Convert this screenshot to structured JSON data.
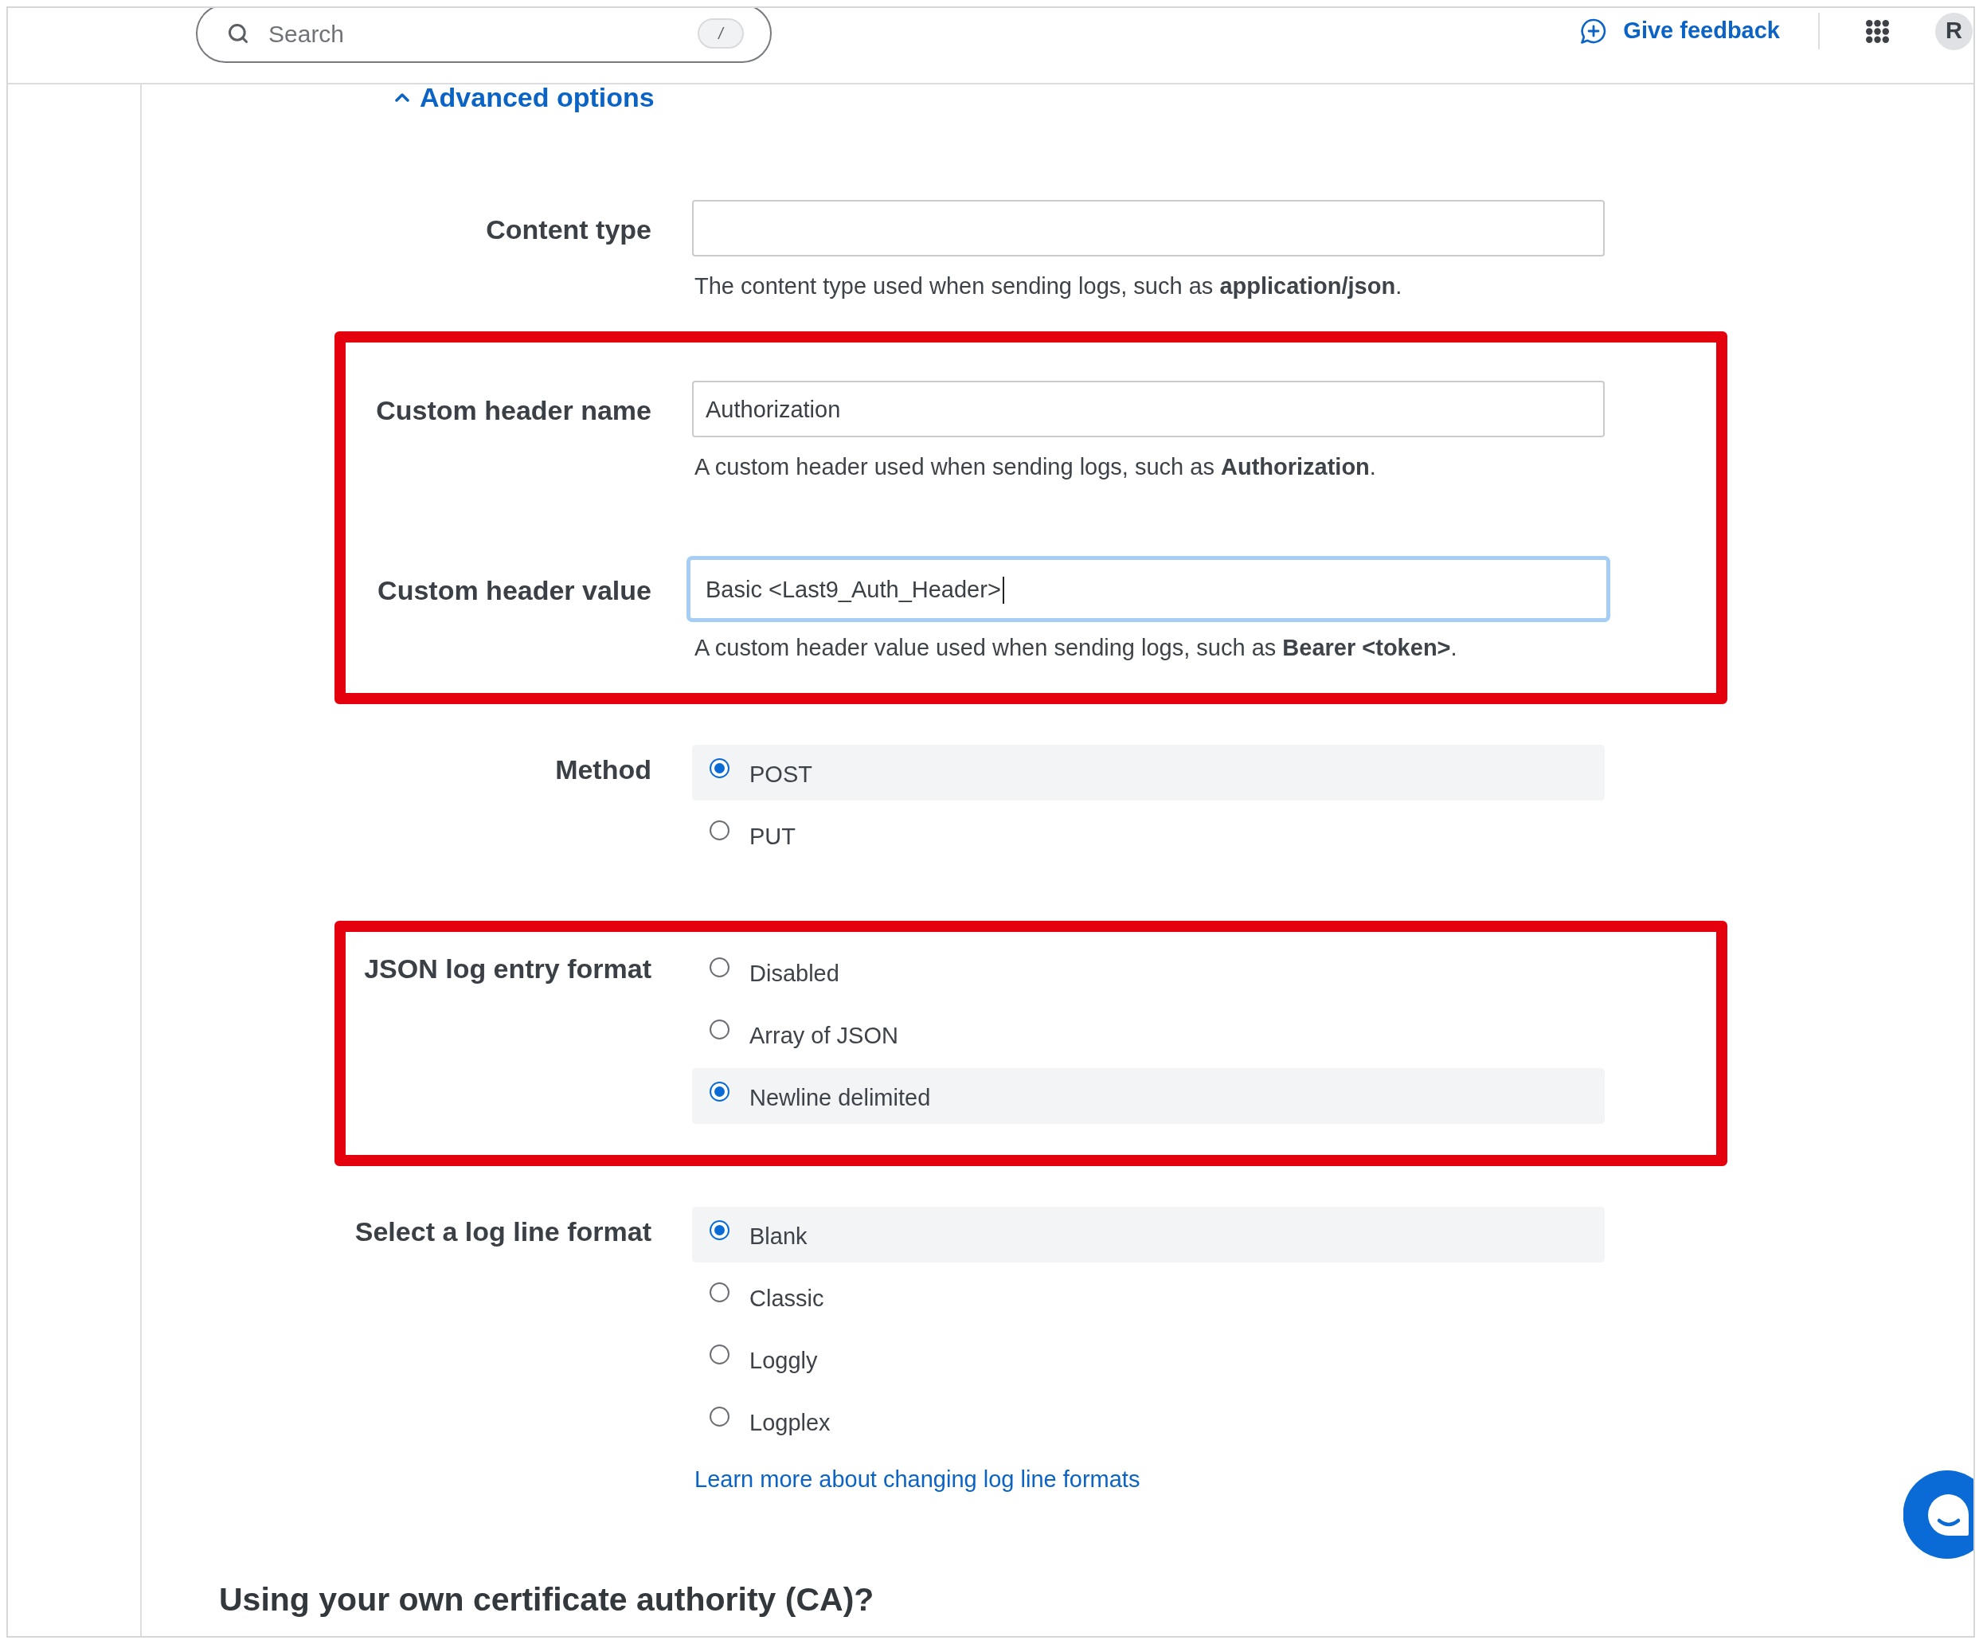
{
  "header": {
    "search": {
      "placeholder": "Search",
      "shortcut": "/"
    },
    "feedback": "Give feedback",
    "avatar": "R"
  },
  "advanced_options": {
    "label": "Advanced options",
    "expanded": true
  },
  "form": {
    "sections": [
      {
        "highlighted": false,
        "fields": [
          {
            "kind": "text",
            "label": "Content type",
            "focused": false,
            "help": "The content type used when sending logs, such as **application/json**."
          }
        ]
      },
      {
        "highlighted": true,
        "fields": [
          {
            "kind": "text",
            "label": "Custom header name",
            "value": "Authorization",
            "focused": false,
            "help": "A custom header used when sending logs, such as **Authorization**."
          },
          {
            "kind": "text",
            "label": "Custom header value",
            "value": "Basic <Last9_Auth_Header>",
            "focused": true,
            "help": "A custom header value used when sending logs, such as **Bearer <token>**."
          }
        ]
      },
      {
        "highlighted": false,
        "fields": [
          {
            "kind": "radio",
            "label": "Method",
            "options": [
              {
                "label": "POST",
                "selected": true
              },
              {
                "label": "PUT",
                "selected": false
              }
            ]
          }
        ]
      },
      {
        "highlighted": true,
        "fields": [
          {
            "kind": "radio",
            "label": "JSON log entry format",
            "options": [
              {
                "label": "Disabled",
                "selected": false
              },
              {
                "label": "Array of JSON",
                "selected": false
              },
              {
                "label": "Newline delimited",
                "selected": true
              }
            ]
          }
        ]
      },
      {
        "highlighted": false,
        "fields": [
          {
            "kind": "radio",
            "label": "Select a log line format",
            "options": [
              {
                "label": "Blank",
                "selected": true
              },
              {
                "label": "Classic",
                "selected": false
              },
              {
                "label": "Loggly",
                "selected": false
              },
              {
                "label": "Logplex",
                "selected": false
              }
            ],
            "link": "Learn more about changing log line formats"
          }
        ]
      }
    ]
  },
  "heading": "Using your own certificate authority (CA)?"
}
